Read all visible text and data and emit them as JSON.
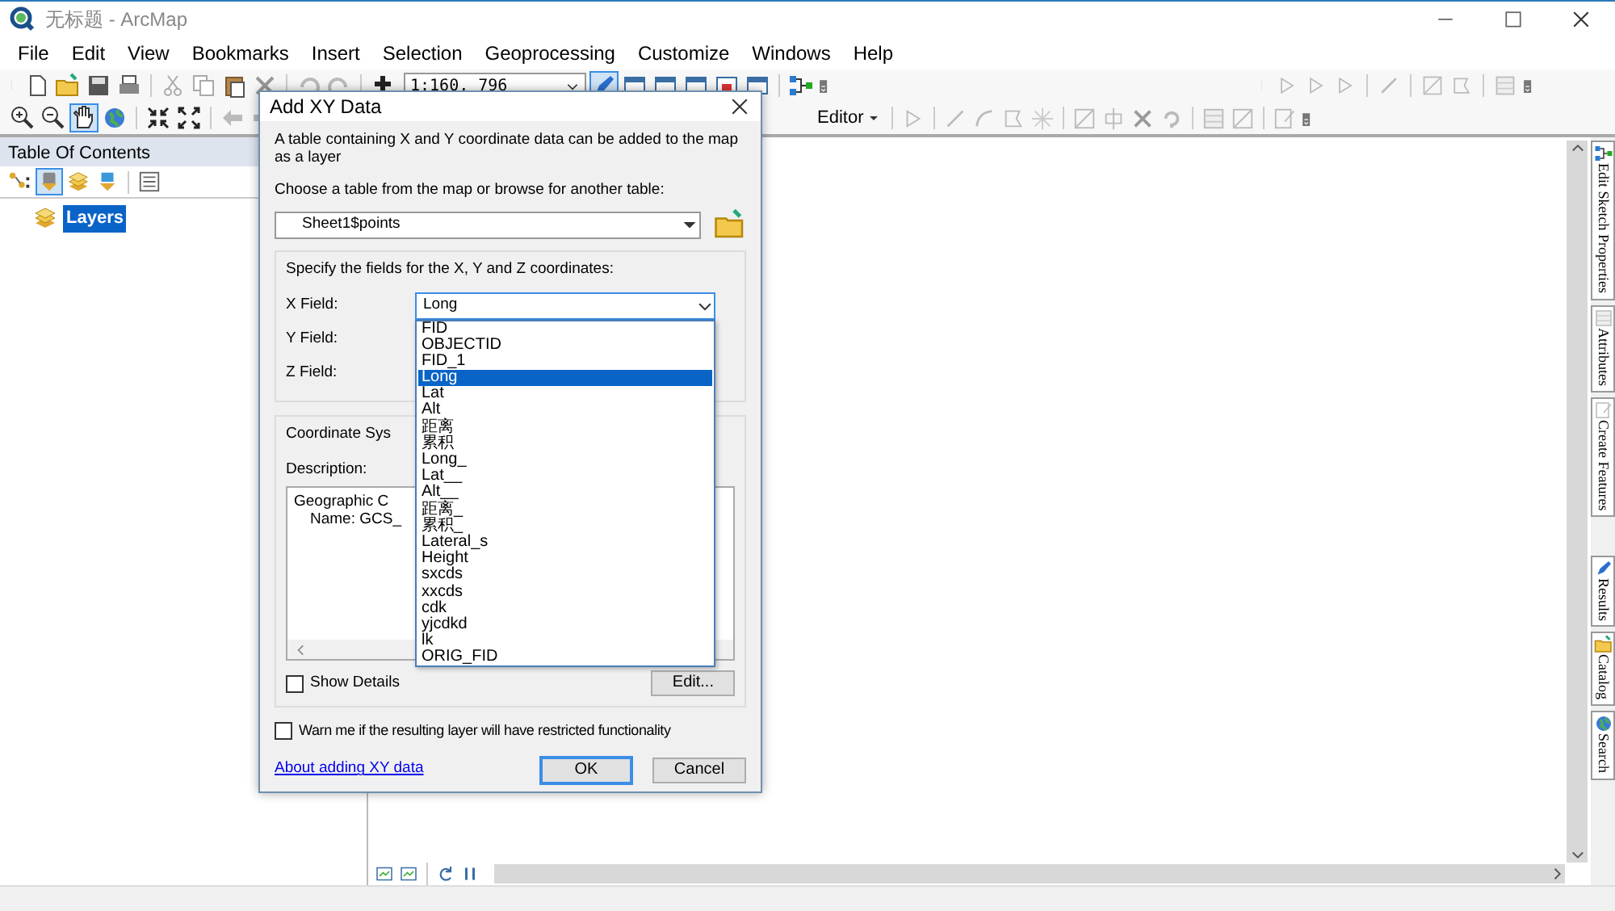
{
  "window": {
    "title": "无标题 - ArcMap"
  },
  "menu": [
    "File",
    "Edit",
    "View",
    "Bookmarks",
    "Insert",
    "Selection",
    "Geoprocessing",
    "Customize",
    "Windows",
    "Help"
  ],
  "scale_box": {
    "value": "1:160, 796"
  },
  "editor_menu": {
    "label": "Editor"
  },
  "toc": {
    "title": "Table Of Contents",
    "items": [
      {
        "label": "Layers",
        "selected": true
      }
    ]
  },
  "dock_tabs": [
    "Edit Sketch Properties",
    "Attributes",
    "Create Features",
    "Results",
    "Catalog",
    "Search"
  ],
  "dialog": {
    "title": "Add XY Data",
    "intro": "A table containing X and Y coordinate data can be added to the map as a layer",
    "table_prompt": "Choose a table from the map or browse for another table:",
    "table_value": "Sheet1$points",
    "fields_group": "Specify the fields for the X, Y and Z coordinates:",
    "fields": [
      {
        "label": "X Field:",
        "value": "Long"
      },
      {
        "label": "Y Field:"
      },
      {
        "label": "Z Field:"
      }
    ],
    "field_list": [
      {
        "label": "FID",
        "selected": false
      },
      {
        "label": "OBJECTID",
        "selected": false
      },
      {
        "label": "FID_1",
        "selected": false
      },
      {
        "label": "Long",
        "selected": true
      },
      {
        "label": "Lat",
        "selected": false
      },
      {
        "label": "Alt",
        "selected": false
      },
      {
        "label": "距离",
        "selected": false
      },
      {
        "label": "累积",
        "selected": false
      },
      {
        "label": "Long_",
        "selected": false
      },
      {
        "label": "Lat__",
        "selected": false
      },
      {
        "label": "Alt__",
        "selected": false
      },
      {
        "label": "距离_",
        "selected": false
      },
      {
        "label": "累积_",
        "selected": false
      },
      {
        "label": "Lateral_s",
        "selected": false
      },
      {
        "label": "Height",
        "selected": false
      },
      {
        "label": "sxcds",
        "selected": false
      },
      {
        "label": "xxcds",
        "selected": false
      },
      {
        "label": "cdk",
        "selected": false
      },
      {
        "label": "yjcdkd",
        "selected": false
      },
      {
        "label": "lk",
        "selected": false
      },
      {
        "label": "ORIG_FID",
        "selected": false
      }
    ],
    "coord_group": "Coordinate Sys",
    "description_label": "Description:",
    "description_lines": [
      "Geographic C",
      "Name: GCS_"
    ],
    "show_details": {
      "label": "Show Details",
      "checked": false
    },
    "edit_button": "Edit...",
    "warn": {
      "label": "Warn me if the resulting layer will have restricted functionality",
      "checked": false
    },
    "help_link": "About adding XY data",
    "buttons": [
      {
        "label": "OK",
        "default": true
      },
      {
        "label": "Cancel",
        "default": false
      }
    ]
  }
}
